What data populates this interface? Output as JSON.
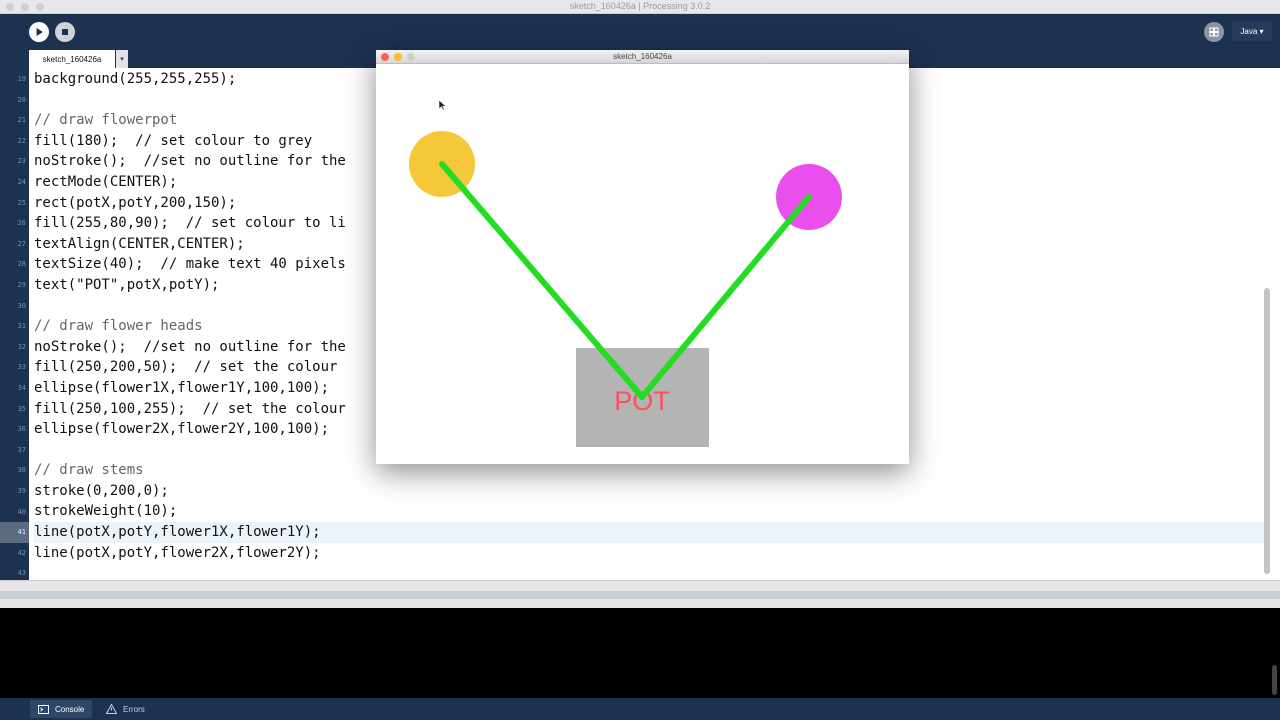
{
  "window": {
    "title": "sketch_160426a | Processing 3.0.2"
  },
  "toolbar": {
    "mode_label": "Java ▾",
    "run_icon": "play-icon",
    "stop_icon": "stop-icon"
  },
  "tab": {
    "name": "sketch_160426a",
    "arrow": "▾"
  },
  "editor": {
    "line_numbers": [
      "19",
      "20",
      "21",
      "22",
      "23",
      "24",
      "25",
      "26",
      "27",
      "28",
      "29",
      "30",
      "31",
      "32",
      "33",
      "34",
      "35",
      "36",
      "37",
      "38",
      "39",
      "40",
      "41",
      "42",
      "43"
    ],
    "lines": [
      "background(255,255,255);",
      "",
      "// draw flowerpot",
      "fill(180);  // set colour to grey",
      "noStroke();  //set no outline for the",
      "rectMode(CENTER);",
      "rect(potX,potY,200,150);",
      "fill(255,80,90);  // set colour to li",
      "textAlign(CENTER,CENTER);",
      "textSize(40);  // make text 40 pixels",
      "text(\"POT\",potX,potY);",
      "",
      "// draw flower heads",
      "noStroke();  //set no outline for the",
      "fill(250,200,50);  // set the colour",
      "ellipse(flower1X,flower1Y,100,100);",
      "fill(250,100,255);  // set the colour",
      "ellipse(flower2X,flower2Y,100,100);",
      "",
      "// draw stems",
      "stroke(0,200,0);",
      "strokeWeight(10);",
      "line(potX,potY,flower1X,flower1Y);",
      "line(potX,potY,flower2X,flower2Y);",
      ""
    ],
    "current_line_index": 22
  },
  "sketch_window": {
    "title": "sketch_160426a",
    "pot_text": "POT"
  },
  "footer": {
    "console_label": "Console",
    "errors_label": "Errors"
  },
  "colors": {
    "pot": "#b4b4b4",
    "pot_text": "#ff505a",
    "flower1": "#f4c838",
    "flower2": "#ea4eec",
    "stem": "#22dd22"
  }
}
